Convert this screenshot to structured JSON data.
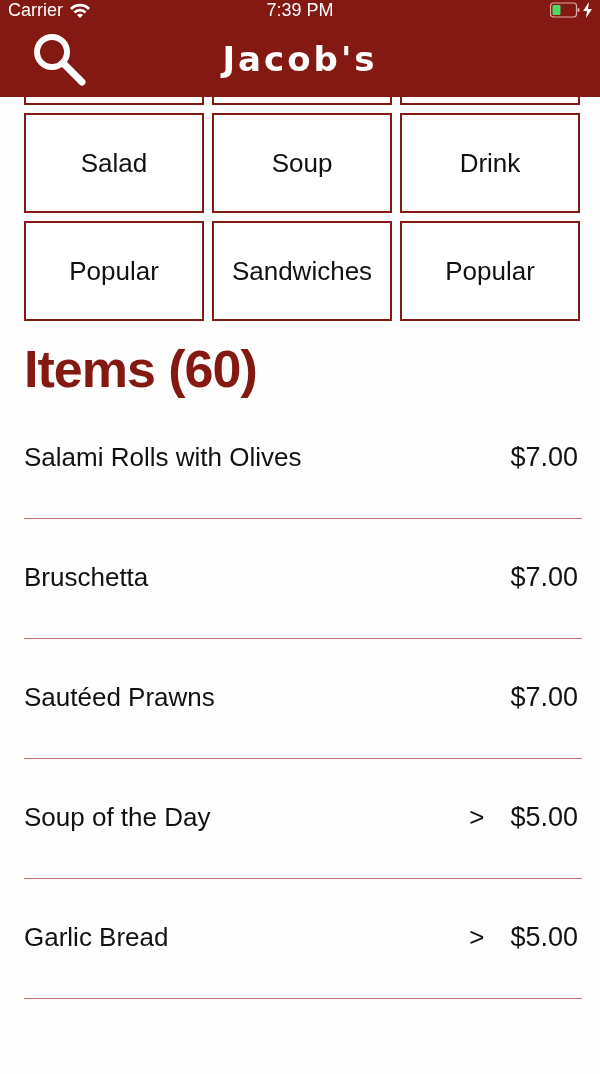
{
  "status_bar": {
    "carrier": "Carrier",
    "time": "7:39 PM",
    "charging": true
  },
  "header": {
    "title": "Jacob's"
  },
  "categories": [
    {
      "label": "Salad"
    },
    {
      "label": "Soup"
    },
    {
      "label": "Drink"
    },
    {
      "label": "Popular"
    },
    {
      "label": "Sandwiches"
    },
    {
      "label": "Popular"
    }
  ],
  "items_heading": "Items (60)",
  "items": [
    {
      "name": "Salami Rolls with Olives",
      "price": "$7.00"
    },
    {
      "name": "Bruschetta",
      "price": "$7.00"
    },
    {
      "name": "Sautéed Prawns",
      "price": "$7.00"
    },
    {
      "name": "Soup of the Day",
      "arrow": ">",
      "price": "$5.00"
    },
    {
      "name": "Garlic Bread",
      "arrow": ">",
      "price": "$5.00"
    }
  ]
}
